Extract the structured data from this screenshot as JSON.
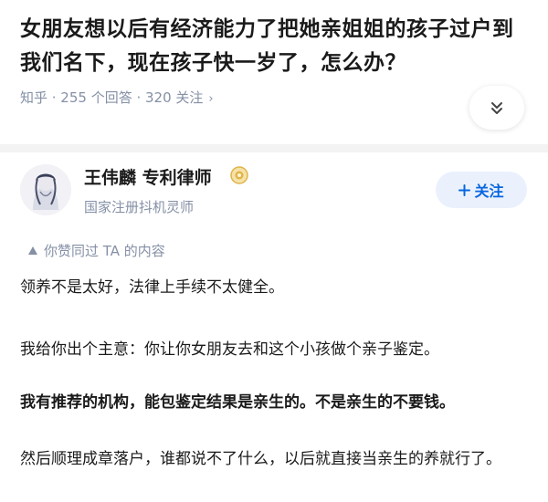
{
  "question": {
    "title": "女朋友想以后有经济能力了把她亲姐姐的孩子过户到我们名下，现在孩子快一岁了，怎么办？",
    "meta": "知乎 · 255 个回答 · 320 关注",
    "meta_chevron": "›"
  },
  "author": {
    "name": "王伟麟 专利律师",
    "description": "国家注册抖机灵师",
    "follow_label": "关注",
    "follow_icon": "plus-icon"
  },
  "voted_note": "你赞同过 TA 的内容",
  "answer": {
    "paragraphs": [
      "领养不是太好，法律上手续不太健全。",
      "我给你出个主意：你让你女朋友去和这个小孩做个亲子鉴定。",
      "我有推荐的机构，能包鉴定结果是亲生的。不是亲生的不要钱。",
      "然后顺理成章落户，谁都说不了什么，以后就直接当亲生的养就行了。"
    ]
  },
  "colors": {
    "accent": "#0866e0",
    "follow_bg": "#eaf1fd",
    "meta_gray": "#8590a6",
    "badge_gold": "#e0b44c"
  }
}
